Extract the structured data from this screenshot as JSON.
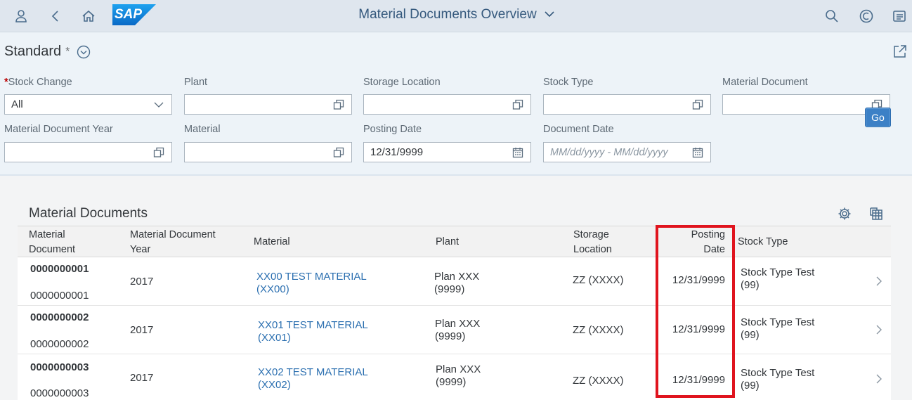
{
  "shell": {
    "title": "Material Documents Overview",
    "logo_text": "SAP"
  },
  "variant": {
    "name": "Standard",
    "dirty_marker": "*"
  },
  "filters": [
    {
      "label": "Stock Change",
      "required": "*",
      "value": "All",
      "type": "select"
    },
    {
      "label": "Plant",
      "value": "",
      "type": "valuehelp"
    },
    {
      "label": "Storage Location",
      "value": "",
      "type": "valuehelp"
    },
    {
      "label": "Stock Type",
      "value": "",
      "type": "valuehelp"
    },
    {
      "label": "Material Document",
      "value": "",
      "type": "valuehelp"
    },
    {
      "label": "Material Document Year",
      "value": "",
      "type": "valuehelp"
    },
    {
      "label": "Material",
      "value": "",
      "type": "valuehelp"
    },
    {
      "label": "Posting Date",
      "value": "12/31/9999",
      "type": "date"
    },
    {
      "label": "Document Date",
      "value": "",
      "placeholder": "MM/dd/yyyy - MM/dd/yyyy",
      "type": "date"
    }
  ],
  "go_label": "Go",
  "table": {
    "title": "Material Documents",
    "columns": {
      "material_document": [
        "Material",
        "Document"
      ],
      "year": [
        "Material Document",
        "Year"
      ],
      "material": "Material",
      "plant": "Plant",
      "storage_location": [
        "Storage",
        "Location"
      ],
      "posting_date": [
        "Posting",
        "Date"
      ],
      "stock_type": "Stock Type"
    },
    "rows": [
      {
        "doc_bold": "0000000001",
        "doc": "0000000001",
        "year": "2017",
        "material": [
          "XX00 TEST MATERIAL",
          "(XX00)"
        ],
        "plant": [
          "Plan XXX",
          "(9999)"
        ],
        "storage": "ZZ (XXXX)",
        "posting_date": "12/31/9999",
        "stock_type": [
          "Stock Type Test",
          "(99)"
        ]
      },
      {
        "doc_bold": "0000000002",
        "doc": "0000000002",
        "year": "2017",
        "material": [
          "XX01 TEST MATERIAL",
          "(XX01)"
        ],
        "plant": [
          "Plan XXX",
          "(9999)"
        ],
        "storage": "ZZ (XXXX)",
        "posting_date": "12/31/9999",
        "stock_type": [
          "Stock Type Test",
          "(99)"
        ]
      },
      {
        "doc_bold": "0000000003",
        "doc": "0000000003",
        "year": "2017",
        "material": [
          "XX02 TEST MATERIAL",
          "(XX02)"
        ],
        "plant": [
          "Plan XXX",
          "(9999)"
        ],
        "storage": "ZZ (XXXX)",
        "posting_date": "12/31/9999",
        "stock_type": [
          "Stock Type Test",
          "(99)"
        ]
      }
    ]
  },
  "colors": {
    "shell_bg": "#dfe6ee",
    "accent": "#3c80c6",
    "link": "#2b6fb0",
    "highlight": "#e0141e"
  },
  "icons": [
    "user-icon",
    "back-icon",
    "home-icon",
    "search-icon",
    "copilot-icon",
    "notifications-icon",
    "variant-dropdown-icon",
    "share-icon",
    "settings-icon",
    "export-icon",
    "value-help-icon",
    "calendar-icon",
    "chevron-down-icon",
    "chevron-right-icon"
  ]
}
